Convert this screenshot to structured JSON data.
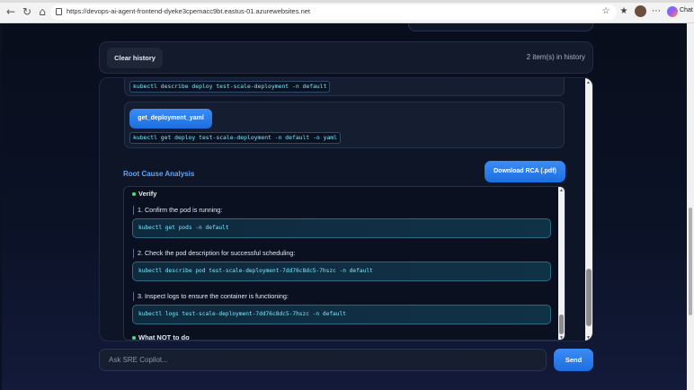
{
  "browser": {
    "url": "https://devops-ai-agent-frontend-dyeke3cpemacc9bt.eastus-01.azurewebsites.net",
    "chat_label": "Chat"
  },
  "history": {
    "clear_label": "Clear history",
    "count_text": "2 item(s) in history"
  },
  "tools": {
    "cmd1": "kubectl describe deploy test-scale-deployment -n default",
    "tool_name": "get_deployment_yaml",
    "cmd2": "kubectl get deploy test-scale-deployment -n default -o yaml"
  },
  "rca": {
    "title": "Root Cause Analysis",
    "download_label": "Download RCA (.pdf)",
    "section1": "Verify",
    "step1": "1. Confirm the pod is running:",
    "code1": "kubectl get pods -n default",
    "step2": "2. Check the pod description for successful scheduling:",
    "code2": "kubectl describe pod test-scale-deployment-7dd76c8dc5-7hszc -n default",
    "step3": "3. Inspect logs to ensure the container is functioning:",
    "code3": "kubectl logs test-scale-deployment-7dd76c8dc5-7hszc -n default",
    "section2": "What NOT to do"
  },
  "composer": {
    "placeholder": "Ask SRE Copilot...",
    "send_label": "Send"
  },
  "colors": {
    "accent": "#2f80ed",
    "code_text": "#7fe7ff",
    "bullet": "#4ade80",
    "rca_title": "#60a5fa"
  }
}
